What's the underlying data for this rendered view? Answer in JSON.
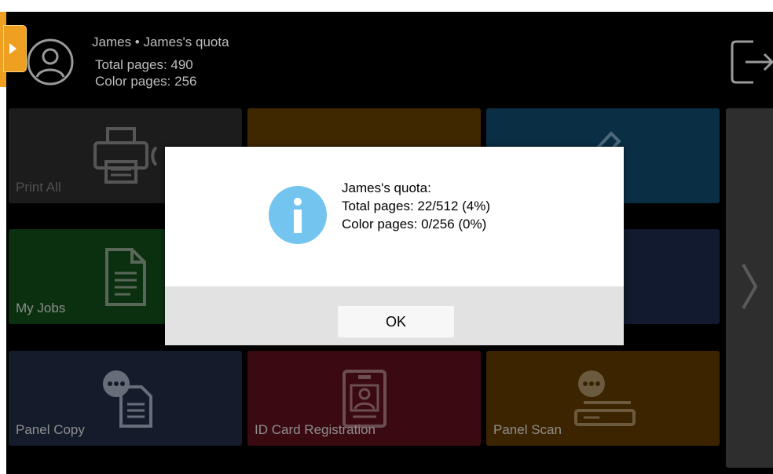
{
  "header": {
    "user_line": "James • James's quota",
    "total_pages": "Total pages: 490",
    "color_pages": "Color pages: 256",
    "logout_icon": "logout-icon",
    "avatar_icon": "user-avatar-icon"
  },
  "tiles": [
    {
      "label": "Print All",
      "icon": "printer-icon",
      "color": "#1c1c1c"
    },
    {
      "label": "",
      "icon": "scan-icon",
      "color": "#3f2700"
    },
    {
      "label": "",
      "icon": "pen-icon",
      "color": "#0a2f45"
    },
    {
      "label": "My Jobs",
      "icon": "document-icon",
      "color": "#0b3010"
    },
    {
      "label": "",
      "icon": "unknown-icon",
      "color": "#111a2e"
    },
    {
      "label": "",
      "icon": "clipboard-icon",
      "color": "#111a2e"
    },
    {
      "label": "Panel Copy",
      "icon": "copy-icon",
      "color": "#141c2c"
    },
    {
      "label": "ID Card Registration",
      "icon": "id-card-icon",
      "color": "#3a0a10"
    },
    {
      "label": "Panel Scan",
      "icon": "scanner-icon",
      "color": "#3d2400"
    }
  ],
  "dialog": {
    "line1": "James's quota:",
    "line2": "Total pages: 22/512 (4%)",
    "line3": "Color pages: 0/256 (0%)",
    "ok_label": "OK",
    "icon": "info-icon",
    "icon_color": "#73c4ee"
  },
  "colors": {
    "accent": "#f0a020",
    "background": "#000000"
  }
}
